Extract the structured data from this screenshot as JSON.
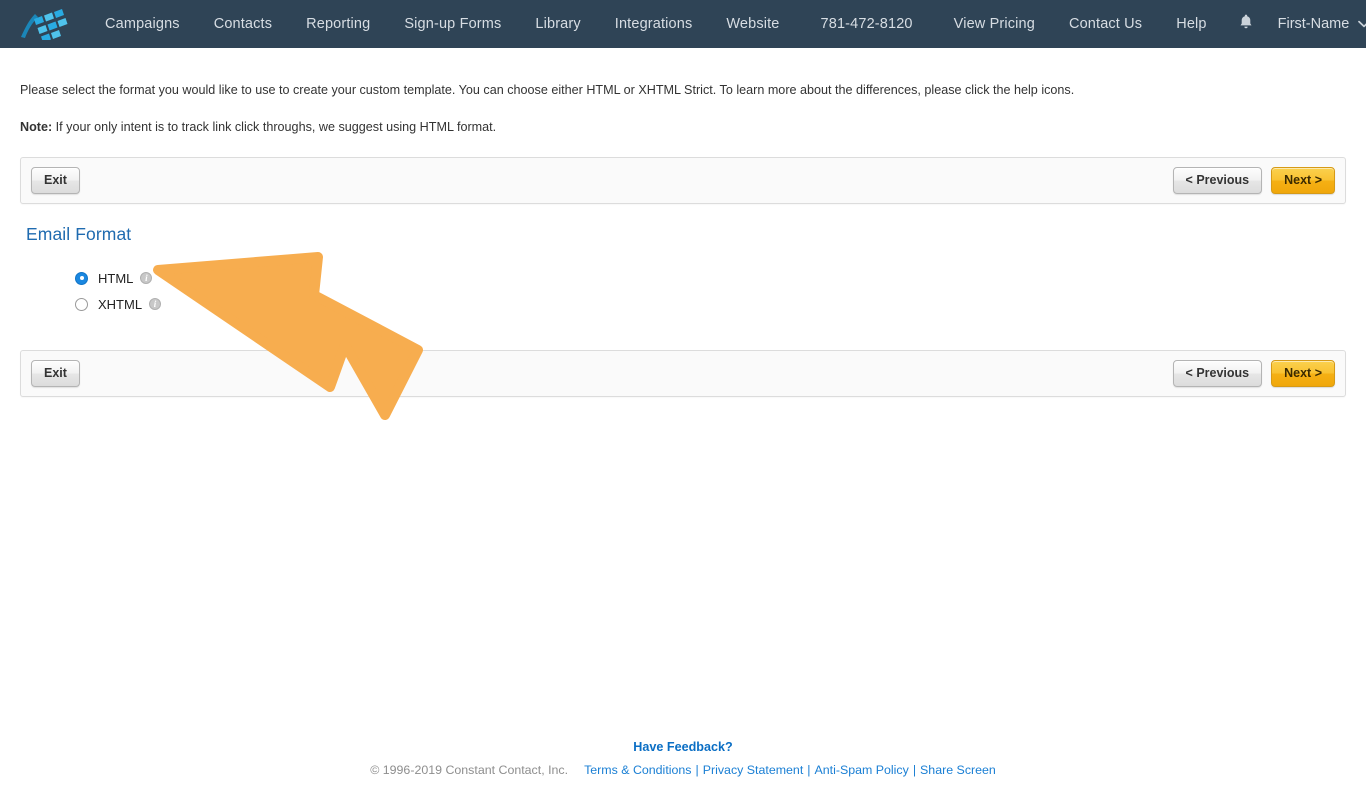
{
  "nav": {
    "logo_icon": "constant-contact-flag-logo",
    "bell_icon": "notification-bell-icon",
    "caret_icon": "chevron-down-icon",
    "items": [
      {
        "label": "Campaigns"
      },
      {
        "label": "Contacts"
      },
      {
        "label": "Reporting"
      },
      {
        "label": "Sign-up Forms"
      },
      {
        "label": "Library"
      },
      {
        "label": "Integrations"
      },
      {
        "label": "Website"
      },
      {
        "label": "781-472-8120"
      },
      {
        "label": "View Pricing"
      },
      {
        "label": "Contact Us"
      },
      {
        "label": "Help"
      }
    ],
    "user_name": "First-Name"
  },
  "page": {
    "intro": "Please select the format you would like to use to create your custom template. You can choose either HTML or XHTML Strict. To learn more about the differences, please click the help icons.",
    "note_label": "Note:",
    "note_text": " If your only intent is to track link click throughs, we suggest using HTML format.",
    "section_title": "Email Format"
  },
  "toolbar": {
    "exit_label": "Exit",
    "previous_label": "< Previous",
    "next_label": "Next >"
  },
  "format_options": [
    {
      "label": "HTML",
      "selected": true,
      "info_icon": "info-icon",
      "info_glyph": "i"
    },
    {
      "label": "XHTML",
      "selected": false,
      "info_icon": "info-icon",
      "info_glyph": "i"
    }
  ],
  "annotation": {
    "arrow_icon": "orange-pointer-arrow",
    "color": "#f7ad4f",
    "points_to": "HTML"
  },
  "footer": {
    "feedback_label": "Have Feedback?",
    "copyright": "© 1996-2019 Constant Contact, Inc.",
    "links": [
      {
        "label": "Terms & Conditions"
      },
      {
        "label": "Privacy Statement"
      },
      {
        "label": "Anti-Spam Policy"
      },
      {
        "label": "Share Screen"
      }
    ],
    "separator": "|"
  },
  "colors": {
    "nav_bg": "#2f4456",
    "accent_blue": "#1f6bb0",
    "primary_button": "#f5b014",
    "arrow_orange": "#f7ad4f",
    "link_blue": "#1a7fd4"
  }
}
